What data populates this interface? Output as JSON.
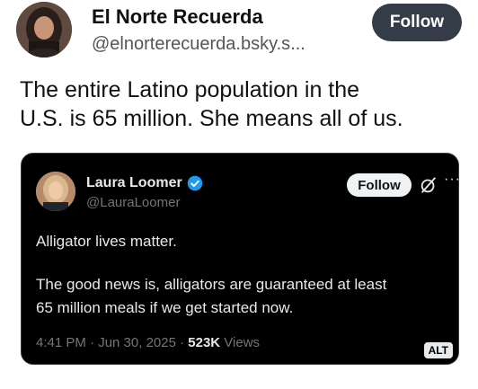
{
  "author": {
    "display_name": "El Norte Recuerda",
    "handle": "@elnorterecuerda.bsky.s...",
    "follow_label": "Follow"
  },
  "post": {
    "text_line1": "The entire Latino population in the",
    "text_line2": "U.S. is 65 million. She means all of us."
  },
  "quoted": {
    "display_name": "Laura Loomer",
    "handle": "@LauraLoomer",
    "follow_label": "Follow",
    "line1": "Alligator lives matter.",
    "line2": "The good news is, alligators are guaranteed at least",
    "line3": "65 million meals if we get started now.",
    "timestamp": "4:41 PM · Jun 30, 2025 · ",
    "views_count": "523K",
    "views_label": " Views",
    "alt_label": "ALT"
  },
  "colors": {
    "follow_bg": "#333c47",
    "card_bg": "#000000",
    "verified_blue": "#1d9bf0"
  }
}
